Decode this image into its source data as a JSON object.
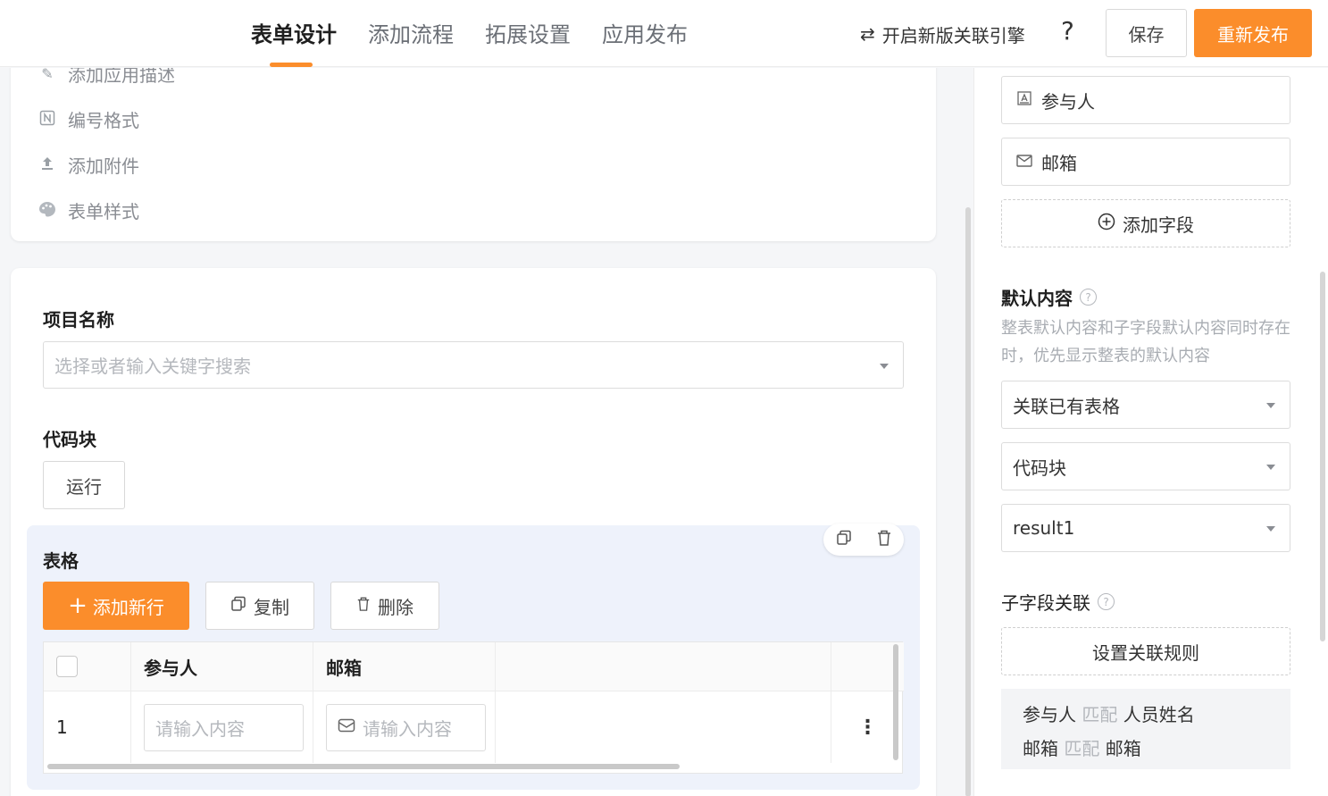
{
  "tabs": [
    {
      "label": "表单设计",
      "active": true
    },
    {
      "label": "添加流程"
    },
    {
      "label": "拓展设置"
    },
    {
      "label": "应用发布"
    }
  ],
  "header": {
    "engine_label": "开启新版关联引擎",
    "help_label": "?",
    "save_label": "保存",
    "publish_label": "重新发布"
  },
  "settings_menu": [
    {
      "label": "添加应用描述",
      "icon": "edit-icon"
    },
    {
      "label": "编号格式",
      "icon": "number-icon"
    },
    {
      "label": "添加附件",
      "icon": "upload-icon"
    },
    {
      "label": "表单样式",
      "icon": "palette-icon"
    }
  ],
  "form": {
    "project_label": "项目名称",
    "project_placeholder": "选择或者输入关键字搜索",
    "code_label": "代码块",
    "run_label": "运行",
    "table_label": "表格",
    "add_row_label": "添加新行",
    "copy_label": "复制",
    "delete_label": "删除",
    "columns": [
      "参与人",
      "邮箱"
    ],
    "rows": [
      {
        "index": "1",
        "participant_placeholder": "请输入内容",
        "email_placeholder": "请输入内容"
      }
    ]
  },
  "side": {
    "fields": [
      {
        "label": "参与人",
        "icon": "person-field-icon"
      },
      {
        "label": "邮箱",
        "icon": "mail-icon"
      }
    ],
    "add_field_label": "添加字段",
    "default_title": "默认内容",
    "default_desc": "整表默认内容和子字段默认内容同时存在时，优先显示整表的默认内容",
    "select_source": "关联已有表格",
    "select_code": "代码块",
    "select_result": "result1",
    "subfield_title": "子字段关联",
    "set_rule_label": "设置关联规则",
    "rules": [
      {
        "left": "参与人",
        "op": "匹配",
        "right": "人员姓名"
      },
      {
        "left": "邮箱",
        "op": "匹配",
        "right": "邮箱"
      }
    ]
  },
  "colors": {
    "accent": "#fb8d2b",
    "table_block_bg": "#eef2fb"
  }
}
